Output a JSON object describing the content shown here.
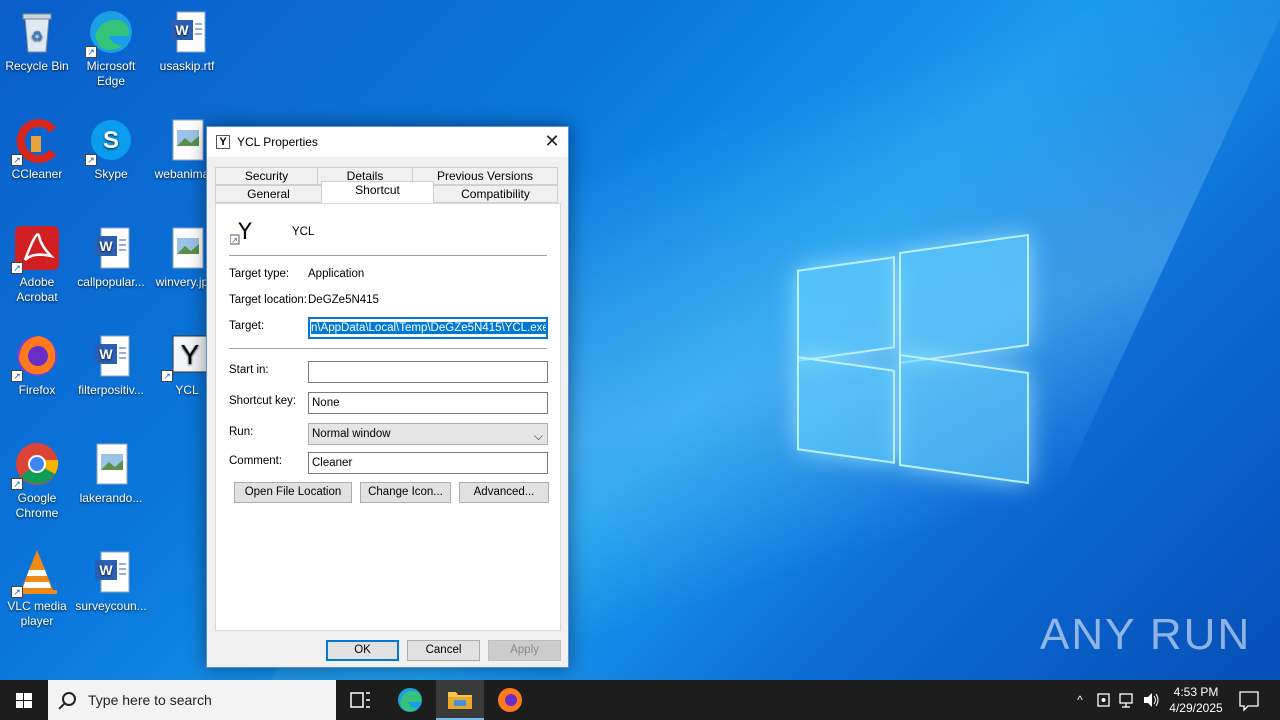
{
  "desktop": {
    "icons": [
      {
        "label": "Recycle Bin"
      },
      {
        "label": "Microsoft Edge"
      },
      {
        "label": "usaskip.rtf"
      },
      {
        "label": "CCleaner"
      },
      {
        "label": "Skype"
      },
      {
        "label": "webanima..."
      },
      {
        "label": "Adobe Acrobat"
      },
      {
        "label": "callpopular..."
      },
      {
        "label": "winvery.jp..."
      },
      {
        "label": "Firefox"
      },
      {
        "label": "filterpositiv..."
      },
      {
        "label": "YCL"
      },
      {
        "label": "Google Chrome"
      },
      {
        "label": "lakerando..."
      },
      {
        "label": "VLC media player"
      },
      {
        "label": "surveycoun..."
      }
    ],
    "watermark": "ANY RUN"
  },
  "dialog": {
    "title": "YCL Properties",
    "tabs_row1": [
      "Security",
      "Details",
      "Previous Versions"
    ],
    "tabs_row2": [
      "General",
      "Shortcut",
      "Compatibility"
    ],
    "active_tab": "Shortcut",
    "app_name": "YCL",
    "target_type_label": "Target type:",
    "target_type_value": "Application",
    "target_location_label": "Target location:",
    "target_location_value": "DeGZe5N415",
    "target_label": "Target:",
    "target_value": "n\\AppData\\Local\\Temp\\DeGZe5N415\\YCL.exe",
    "start_in_label": "Start in:",
    "start_in_value": "",
    "shortcut_key_label": "Shortcut key:",
    "shortcut_key_value": "None",
    "run_label": "Run:",
    "run_value": "Normal window",
    "comment_label": "Comment:",
    "comment_value": "Cleaner",
    "open_file_location": "Open File Location",
    "change_icon": "Change Icon...",
    "advanced": "Advanced...",
    "ok": "OK",
    "cancel": "Cancel",
    "apply": "Apply"
  },
  "taskbar": {
    "search_placeholder": "Type here to search",
    "time": "4:53 PM",
    "date": "4/29/2025"
  }
}
